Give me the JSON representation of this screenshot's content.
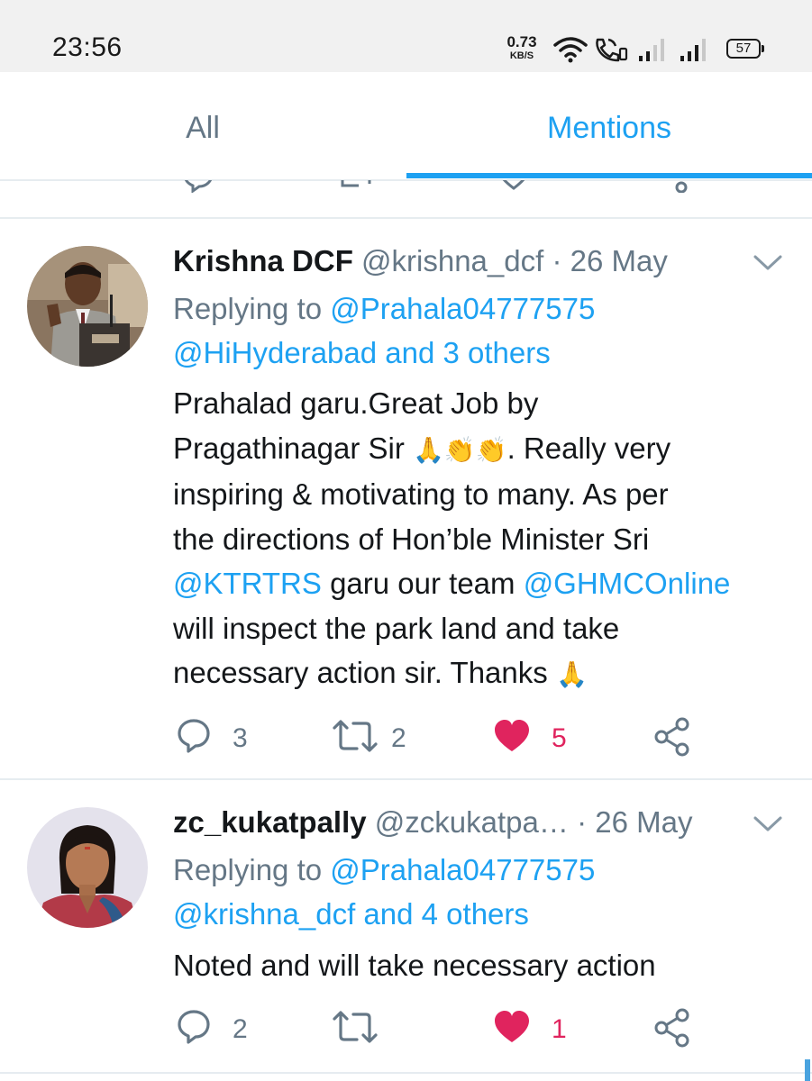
{
  "status_bar": {
    "time": "23:56",
    "net_speed_value": "0.73",
    "net_speed_unit": "KB/S",
    "battery": "57",
    "icons": [
      "wifi-icon",
      "volte-call-icon",
      "signal-icon",
      "signal-icon"
    ]
  },
  "tabs": [
    {
      "label": "All",
      "active": false
    },
    {
      "label": "Mentions",
      "active": true
    }
  ],
  "colors": {
    "accent": "#1da1f2",
    "text": "#14171a",
    "muted": "#657786",
    "like": "#e0245e",
    "divider": "#e6ecf0"
  },
  "tweets": [
    {
      "display_name": "Krishna DCF",
      "handle": "@krishna_dcf",
      "separator": "·",
      "date": "26 May",
      "replying_prefix": "Replying to",
      "replying_user": "@Prahala04777575",
      "replying_rest": "@HiHyderabad and 3 others",
      "body": {
        "t1": "Prahalad garu.Great Job by",
        "t2": "Pragathinagar Sir",
        "e1": "🙏👏👏",
        "t3": ". Really very",
        "t4": "inspiring & motivating to many. As per",
        "t5": "the directions of Hon’ble Minister Sri",
        "m1": "@KTRTRS",
        "t6": " garu our team ",
        "m2": "@GHMCOnline",
        "t7": "will inspect the park land and take",
        "t8": "necessary action sir. Thanks",
        "e2": "🙏"
      },
      "replies": "3",
      "retweets": "2",
      "likes": "5",
      "liked": true,
      "icons": [
        "reply-icon",
        "retweet-icon",
        "heart-icon",
        "share-icon",
        "chevron-down-icon"
      ]
    },
    {
      "display_name": "zc_kukatpally",
      "handle": "@zckukatpa…",
      "separator": "·",
      "date": "26 May",
      "replying_prefix": "Replying to",
      "replying_user": "@Prahala04777575",
      "replying_rest": "@krishna_dcf and 4 others",
      "body": {
        "t1": "Noted and will take necessary action"
      },
      "replies": "2",
      "retweets": "",
      "likes": "1",
      "liked": true,
      "icons": [
        "reply-icon",
        "retweet-icon",
        "heart-icon",
        "share-icon",
        "chevron-down-icon"
      ]
    }
  ]
}
